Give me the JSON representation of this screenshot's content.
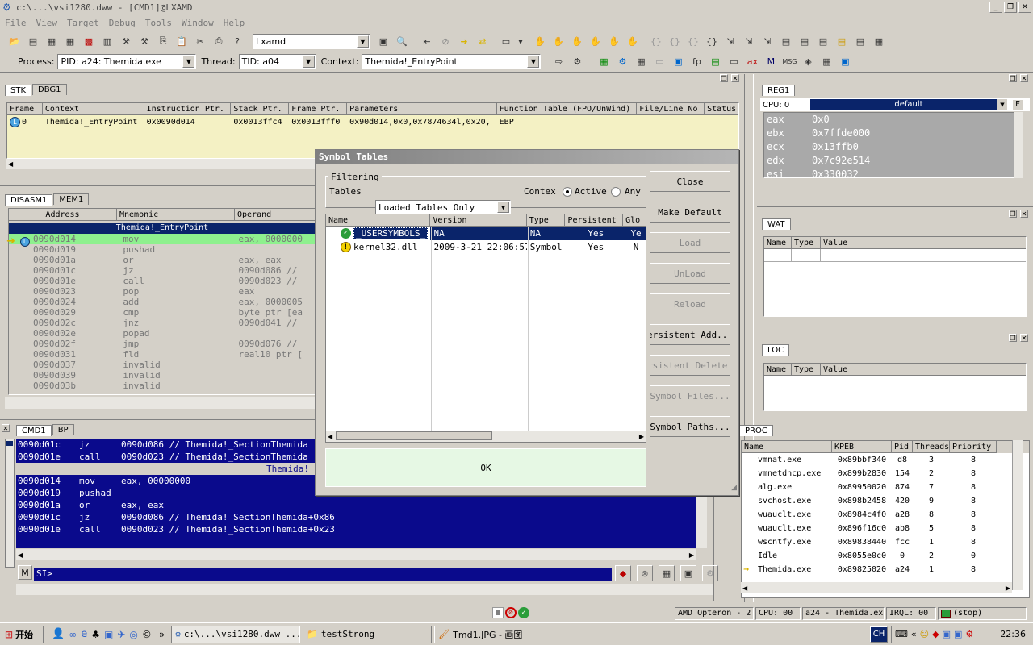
{
  "title": "c:\\...\\vsi1280.dww - [CMD1]@LXAMD",
  "menu": [
    "File",
    "View",
    "Target",
    "Debug",
    "Tools",
    "Window",
    "Help"
  ],
  "toolbar": {
    "target_combo": "Lxamd"
  },
  "procbar": {
    "process_label": "Process:",
    "process_value": "PID: a24: Themida.exe",
    "thread_label": "Thread:",
    "thread_value": "TID: a04",
    "context_label": "Context:",
    "context_value": "Themida!_EntryPoint"
  },
  "stk": {
    "tabs": [
      "STK",
      "DBG1"
    ],
    "columns": [
      "Frame",
      "Context",
      "Instruction Ptr.",
      "Stack Ptr.",
      "Frame Ptr.",
      "Parameters",
      "Function Table (FPO/UnWind)",
      "File/Line No",
      "Status"
    ],
    "row": [
      "0",
      "Themida!_EntryPoint",
      "0x0090d014",
      "0x0013ffc4",
      "0x0013fff0",
      "0x90d014,0x0,0x7874634l,0x20,",
      "EBP",
      "",
      ""
    ]
  },
  "disasm": {
    "tabs": [
      "DISASM1",
      "MEM1"
    ],
    "columns": [
      "Address",
      "Mnemonic",
      "Operand"
    ],
    "banner": "Themida!_EntryPoint",
    "rows": [
      [
        "0090d014",
        "mov",
        "eax, 0000000"
      ],
      [
        "0090d019",
        "pushad",
        ""
      ],
      [
        "0090d01a",
        "or",
        "eax, eax"
      ],
      [
        "0090d01c",
        "jz",
        "0090d086 //"
      ],
      [
        "0090d01e",
        "call",
        "0090d023 //"
      ],
      [
        "0090d023",
        "pop",
        "eax"
      ],
      [
        "0090d024",
        "add",
        "eax, 0000005"
      ],
      [
        "0090d029",
        "cmp",
        "byte ptr [ea"
      ],
      [
        "0090d02c",
        "jnz",
        "0090d041 //"
      ],
      [
        "0090d02e",
        "popad",
        ""
      ],
      [
        "0090d02f",
        "jmp",
        "0090d076 //"
      ],
      [
        "0090d031",
        "fld",
        "real10 ptr ["
      ],
      [
        "0090d037",
        "invalid",
        ""
      ],
      [
        "0090d039",
        "invalid",
        ""
      ],
      [
        "0090d03b",
        "invalid",
        ""
      ]
    ]
  },
  "reg": {
    "tab": "REG1",
    "cpu_label": "CPU: 0",
    "profile": "default",
    "f_btn": "F",
    "rows": [
      [
        "eax",
        "0x0"
      ],
      [
        "ebx",
        "0x7ffde000"
      ],
      [
        "ecx",
        "0x13ffb0"
      ],
      [
        "edx",
        "0x7c92e514"
      ],
      [
        "esi",
        "0x330032"
      ]
    ]
  },
  "wat": {
    "tab": "WAT",
    "columns": [
      "Name",
      "Type",
      "Value"
    ]
  },
  "loc": {
    "tab": "LOC",
    "columns": [
      "Name",
      "Type",
      "Value"
    ]
  },
  "cmd": {
    "tabs": [
      "CMD1",
      "BP"
    ],
    "banner": "Themida!",
    "lines_top": [
      [
        "0090d01c",
        "jz",
        "0090d086 // Themida!_SectionThemida"
      ],
      [
        "0090d01e",
        "call",
        "0090d023 // Themida!_SectionThemida"
      ]
    ],
    "lines": [
      [
        "0090d014",
        "mov",
        "eax, 00000000"
      ],
      [
        "0090d019",
        "pushad",
        ""
      ],
      [
        "0090d01a",
        "or",
        "eax, eax"
      ],
      [
        "0090d01c",
        "jz",
        "0090d086 // Themida!_SectionThemida+0x86"
      ],
      [
        "0090d01e",
        "call",
        "0090d023 // Themida!_SectionThemida+0x23"
      ]
    ],
    "prompt": "SI>"
  },
  "proc": {
    "tab": "PROC",
    "columns": [
      "Name",
      "KPEB",
      "Pid",
      "Threads",
      "Priority"
    ],
    "rows": [
      [
        "vmnat.exe",
        "0x89bbf340",
        "d8",
        "3",
        "8"
      ],
      [
        "vmnetdhcp.exe",
        "0x899b2830",
        "154",
        "2",
        "8"
      ],
      [
        "alg.exe",
        "0x89950020",
        "874",
        "7",
        "8"
      ],
      [
        "svchost.exe",
        "0x898b2458",
        "420",
        "9",
        "8"
      ],
      [
        "wuauclt.exe",
        "0x8984c4f0",
        "a28",
        "8",
        "8"
      ],
      [
        "wuauclt.exe",
        "0x896f16c0",
        "ab8",
        "5",
        "8"
      ],
      [
        "wscntfy.exe",
        "0x89838440",
        "fcc",
        "1",
        "8"
      ],
      [
        "Idle",
        "0x8055e0c0",
        "0",
        "2",
        "0"
      ],
      [
        "Themida.exe",
        "0x89825020",
        "a24",
        "1",
        "8"
      ]
    ]
  },
  "dialog": {
    "title": "Symbol Tables",
    "filtering": "Filtering",
    "tables_label": "Tables",
    "tables_value": "Loaded Tables Only",
    "context_label": "Contex",
    "active": "Active",
    "any": "Any",
    "columns": [
      "Name",
      "Version",
      "Type",
      "Persistent",
      "Glo"
    ],
    "rows": [
      [
        "_USERSYMBOLS_",
        "NA",
        "NA",
        "Yes",
        "Ye"
      ],
      [
        "kernel32.dll",
        "2009-3-21 22:06:57",
        "Symbol",
        "Yes",
        "N"
      ]
    ],
    "buttons": [
      {
        "label": "Close",
        "enabled": true
      },
      {
        "label": "Make Default",
        "enabled": true
      },
      {
        "label": "Load",
        "enabled": false
      },
      {
        "label": "UnLoad",
        "enabled": false
      },
      {
        "label": "Reload",
        "enabled": false
      },
      {
        "label": "ersistent Add...",
        "enabled": true
      },
      {
        "label": "rsistent Delete.",
        "enabled": false
      },
      {
        "label": "Symbol Files...",
        "enabled": false
      },
      {
        "label": "Symbol Paths...",
        "enabled": true
      }
    ],
    "ok": "OK"
  },
  "status": {
    "cpu_model": "AMD Opteron - 2",
    "cpu": "CPU: 00",
    "proc": "a24 - Themida.exe",
    "irql": "IRQL: 00",
    "state": "(stop)"
  },
  "taskbar": {
    "start": "开始",
    "tasks": [
      "c:\\...\\vsi1280.dww ...",
      "testStrong",
      "Tmd1.JPG - 画图"
    ],
    "lang": "CH",
    "time": "22:36"
  }
}
